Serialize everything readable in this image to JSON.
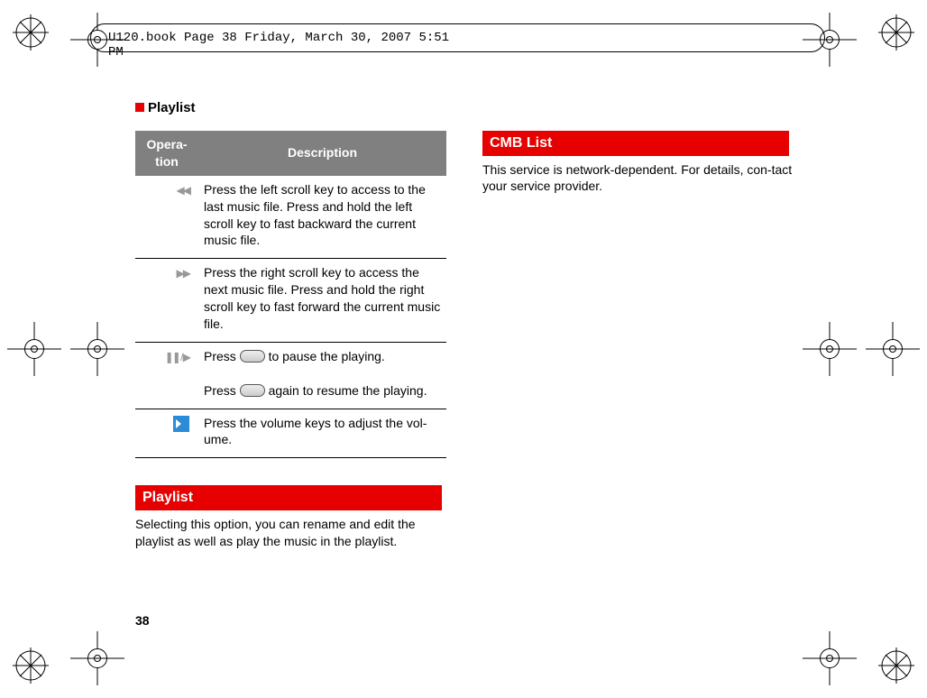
{
  "header": "U120.book  Page 38  Friday, March 30, 2007  5:51 PM",
  "section_title": "Playlist",
  "table": {
    "head_op": "Opera-\ntion",
    "head_desc": "Description",
    "rows": [
      {
        "icon": "rewind-icon",
        "glyph": "◀◀",
        "desc": "Press the left scroll key to access to the last music file. Press and hold the left scroll key to fast backward the current music file."
      },
      {
        "icon": "forward-icon",
        "glyph": "▶▶",
        "desc": "Press the right scroll key to access the next music file. Press and hold the right scroll key to fast forward the current music file."
      },
      {
        "icon": "pause-play-icon",
        "glyph": "❚❚ / ▶",
        "desc_pre": "Press ",
        "desc_mid": " to pause the playing.",
        "desc_pre2": "Press ",
        "desc_post": " again to resume the playing."
      },
      {
        "icon": "volume-icon",
        "glyph": "",
        "desc": "Press the volume keys to adjust the vol-ume."
      }
    ]
  },
  "playlist_header": " Playlist",
  "playlist_body": "Selecting this option, you can rename and edit the playlist as well as play the music in the playlist.",
  "cmb_header": " CMB List",
  "cmb_body": "This service is network-dependent. For details, con-tact your service provider.",
  "page_number": "38"
}
